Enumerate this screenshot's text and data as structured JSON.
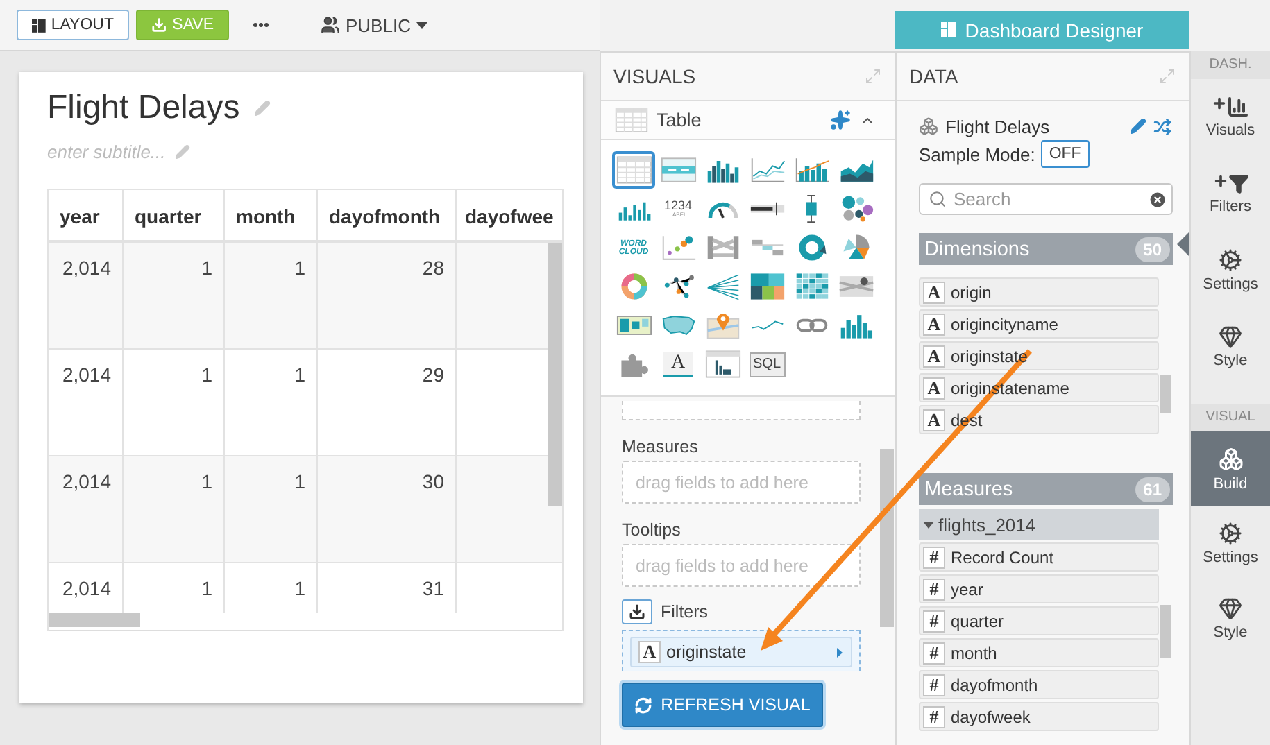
{
  "toolbar": {
    "layout": "LAYOUT",
    "save": "SAVE",
    "visibility": "PUBLIC"
  },
  "designer_title": "Dashboard Designer",
  "dashboard": {
    "title": "Flight Delays",
    "subtitle_placeholder": "enter subtitle...",
    "table": {
      "columns": [
        "year",
        "quarter",
        "month",
        "dayofmonth",
        "dayofwee"
      ],
      "rows": [
        [
          "2,014",
          "1",
          "1",
          "28"
        ],
        [
          "2,014",
          "1",
          "1",
          "29"
        ],
        [
          "2,014",
          "1",
          "1",
          "30"
        ],
        [
          "2,014",
          "1",
          "1",
          "31"
        ]
      ]
    }
  },
  "visuals": {
    "title": "VISUALS",
    "current": "Table",
    "types": [
      {
        "kind": "table",
        "selected": true
      },
      {
        "kind": "crosstab",
        "selected": false
      },
      {
        "kind": "histogram",
        "selected": false
      },
      {
        "kind": "lines",
        "selected": false
      },
      {
        "kind": "combo",
        "selected": false
      },
      {
        "kind": "area",
        "selected": false
      },
      {
        "kind": "bars",
        "selected": false
      },
      {
        "kind": "kpi",
        "labels": [
          "1234",
          "LABEL"
        ],
        "selected": false
      },
      {
        "kind": "gauge",
        "selected": false
      },
      {
        "kind": "bullet",
        "selected": false
      },
      {
        "kind": "boxplot",
        "selected": false
      },
      {
        "kind": "bubbles",
        "selected": false
      },
      {
        "kind": "wordcloud",
        "labels": [
          "WORD",
          "CLOUD"
        ],
        "selected": false
      },
      {
        "kind": "scatter",
        "selected": false
      },
      {
        "kind": "parallel",
        "selected": false
      },
      {
        "kind": "steps",
        "selected": false
      },
      {
        "kind": "donut",
        "selected": false
      },
      {
        "kind": "pie",
        "selected": false
      },
      {
        "kind": "chord",
        "selected": false
      },
      {
        "kind": "network",
        "selected": false
      },
      {
        "kind": "fan",
        "selected": false
      },
      {
        "kind": "treemap",
        "selected": false
      },
      {
        "kind": "heatmap",
        "selected": false
      },
      {
        "kind": "gearbands",
        "selected": false
      },
      {
        "kind": "mapregions",
        "selected": false
      },
      {
        "kind": "usmap",
        "selected": false
      },
      {
        "kind": "pinmap",
        "selected": false
      },
      {
        "kind": "sparkline",
        "selected": false
      },
      {
        "kind": "link",
        "selected": false
      },
      {
        "kind": "bars2",
        "selected": false
      },
      {
        "kind": "puzzle",
        "selected": false
      },
      {
        "kind": "richtext",
        "labels": [
          "A"
        ],
        "selected": false
      },
      {
        "kind": "fieldtable",
        "selected": false
      },
      {
        "kind": "sql",
        "labels": [
          "SQL"
        ],
        "selected": false
      }
    ],
    "shelves": [
      {
        "label": "Measures",
        "placeholder": "drag fields to add here"
      },
      {
        "label": "Tooltips",
        "placeholder": "drag fields to add here"
      }
    ],
    "filters": {
      "label": "Filters",
      "fields": [
        {
          "glyph": "A",
          "name": "originstate"
        }
      ]
    },
    "refresh": "REFRESH VISUAL"
  },
  "data": {
    "title": "DATA",
    "dataset": "Flight Delays",
    "sample_mode_label": "Sample Mode:",
    "sample_mode": "OFF",
    "search_placeholder": "Search",
    "dimensions": {
      "title": "Dimensions",
      "count": "50",
      "fields": [
        {
          "glyph": "A",
          "name": "origin"
        },
        {
          "glyph": "A",
          "name": "origincityname"
        },
        {
          "glyph": "A",
          "name": "originstate"
        },
        {
          "glyph": "A",
          "name": "originstatename"
        },
        {
          "glyph": "A",
          "name": "dest"
        }
      ]
    },
    "measures": {
      "title": "Measures",
      "count": "61",
      "groups": [
        {
          "name": "flights_2014",
          "expanded": true,
          "children": [
            {
              "glyph": "#",
              "name": "Record Count"
            },
            {
              "glyph": "#",
              "name": "year"
            },
            {
              "glyph": "#",
              "name": "quarter"
            },
            {
              "glyph": "#",
              "name": "month"
            },
            {
              "glyph": "#",
              "name": "dayofmonth"
            },
            {
              "glyph": "#",
              "name": "dayofweek"
            }
          ]
        }
      ]
    }
  },
  "sidebar": {
    "sections": [
      {
        "title": "DASH.",
        "items": [
          {
            "kind": "visuals",
            "label": "Visuals",
            "selected": false
          },
          {
            "kind": "filters",
            "label": "Filters",
            "selected": false
          },
          {
            "kind": "settings",
            "label": "Settings",
            "selected": false
          },
          {
            "kind": "style",
            "label": "Style",
            "selected": false
          }
        ]
      },
      {
        "title": "VISUAL",
        "items": [
          {
            "kind": "build",
            "label": "Build",
            "selected": true
          },
          {
            "kind": "settings",
            "label": "Settings",
            "selected": false
          },
          {
            "kind": "style",
            "label": "Style",
            "selected": false
          }
        ]
      }
    ]
  }
}
